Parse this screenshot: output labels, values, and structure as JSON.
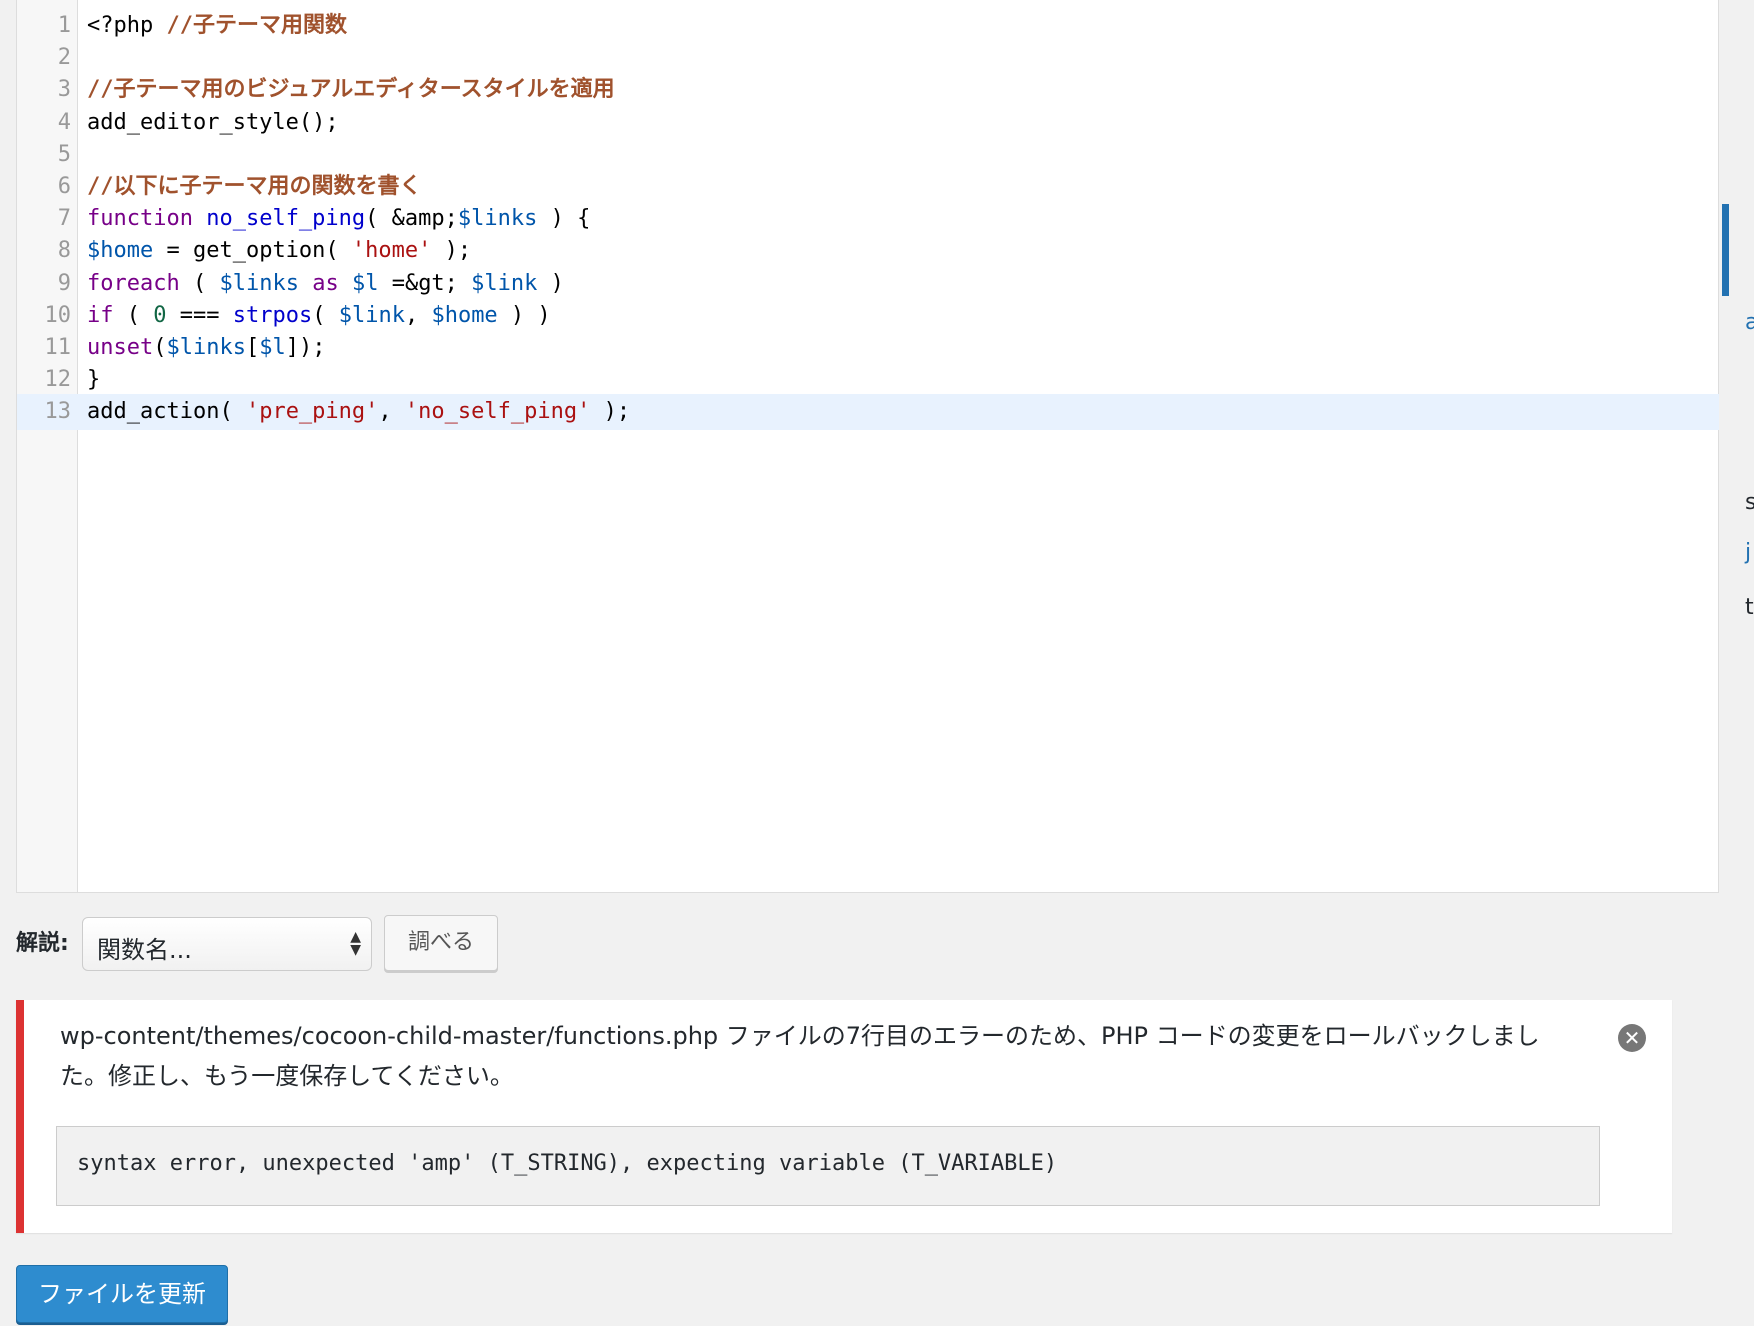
{
  "editor": {
    "lines": [
      {
        "number": "1",
        "tokens": [
          {
            "t": "<?php ",
            "c": "plain"
          },
          {
            "t": "//子テーマ用関数",
            "c": "comment"
          }
        ]
      },
      {
        "number": "2",
        "tokens": []
      },
      {
        "number": "3",
        "tokens": [
          {
            "t": "//子テーマ用のビジュアルエディタースタイルを適用",
            "c": "comment"
          }
        ]
      },
      {
        "number": "4",
        "tokens": [
          {
            "t": "add_editor_style();",
            "c": "plain"
          }
        ]
      },
      {
        "number": "5",
        "tokens": []
      },
      {
        "number": "6",
        "tokens": [
          {
            "t": "//以下に子テーマ用の関数を書く",
            "c": "comment"
          }
        ]
      },
      {
        "number": "7",
        "tokens": [
          {
            "t": "function",
            "c": "kw"
          },
          {
            "t": " ",
            "c": "plain"
          },
          {
            "t": "no_self_ping",
            "c": "fn"
          },
          {
            "t": "( &amp;",
            "c": "plain"
          },
          {
            "t": "$links",
            "c": "var"
          },
          {
            "t": " ) {",
            "c": "plain"
          }
        ]
      },
      {
        "number": "8",
        "tokens": [
          {
            "t": "$home",
            "c": "var"
          },
          {
            "t": " = get_option( ",
            "c": "plain"
          },
          {
            "t": "'home'",
            "c": "str"
          },
          {
            "t": " );",
            "c": "plain"
          }
        ]
      },
      {
        "number": "9",
        "tokens": [
          {
            "t": "foreach",
            "c": "kw"
          },
          {
            "t": " ( ",
            "c": "plain"
          },
          {
            "t": "$links",
            "c": "var"
          },
          {
            "t": " ",
            "c": "plain"
          },
          {
            "t": "as",
            "c": "kw"
          },
          {
            "t": " ",
            "c": "plain"
          },
          {
            "t": "$l",
            "c": "var"
          },
          {
            "t": " =&gt; ",
            "c": "plain"
          },
          {
            "t": "$link",
            "c": "var"
          },
          {
            "t": " )",
            "c": "plain"
          }
        ]
      },
      {
        "number": "10",
        "tokens": [
          {
            "t": "if",
            "c": "kw"
          },
          {
            "t": " ( ",
            "c": "plain"
          },
          {
            "t": "0",
            "c": "num"
          },
          {
            "t": " === ",
            "c": "plain"
          },
          {
            "t": "strpos",
            "c": "fn"
          },
          {
            "t": "( ",
            "c": "plain"
          },
          {
            "t": "$link",
            "c": "var"
          },
          {
            "t": ", ",
            "c": "plain"
          },
          {
            "t": "$home",
            "c": "var"
          },
          {
            "t": " ) )",
            "c": "plain"
          }
        ]
      },
      {
        "number": "11",
        "tokens": [
          {
            "t": "unset",
            "c": "kw"
          },
          {
            "t": "(",
            "c": "plain"
          },
          {
            "t": "$links",
            "c": "var"
          },
          {
            "t": "[",
            "c": "plain"
          },
          {
            "t": "$l",
            "c": "var"
          },
          {
            "t": "]);",
            "c": "plain"
          }
        ]
      },
      {
        "number": "12",
        "tokens": [
          {
            "t": "}",
            "c": "plain"
          }
        ]
      },
      {
        "number": "13",
        "tokens": [
          {
            "t": "add_action( ",
            "c": "plain"
          },
          {
            "t": "'pre_ping'",
            "c": "str"
          },
          {
            "t": ", ",
            "c": "plain"
          },
          {
            "t": "'no_self_ping'",
            "c": "str"
          },
          {
            "t": " );",
            "c": "plain"
          }
        ]
      }
    ],
    "active_line": "13"
  },
  "lookup": {
    "label": "解説:",
    "select_value": "関数名...",
    "button_label": "調べる"
  },
  "notice": {
    "message": "wp-content/themes/cocoon-child-master/functions.php ファイルの7行目のエラーのため、PHP コードの変更をロールバックしました。修正し、もう一度保存してください。",
    "error_detail": "syntax error, unexpected 'amp' (T_STRING), expecting variable (T_VARIABLE)",
    "dismiss_icon": "close-circle-icon"
  },
  "update_button_label": "ファイルを更新",
  "sidebar_fragments": [
    "a",
    "s",
    "j",
    "t"
  ],
  "colors": {
    "error_accent": "#dc3232",
    "primary_button": "#2e8ccf",
    "active_line": "#e8f2fe"
  }
}
